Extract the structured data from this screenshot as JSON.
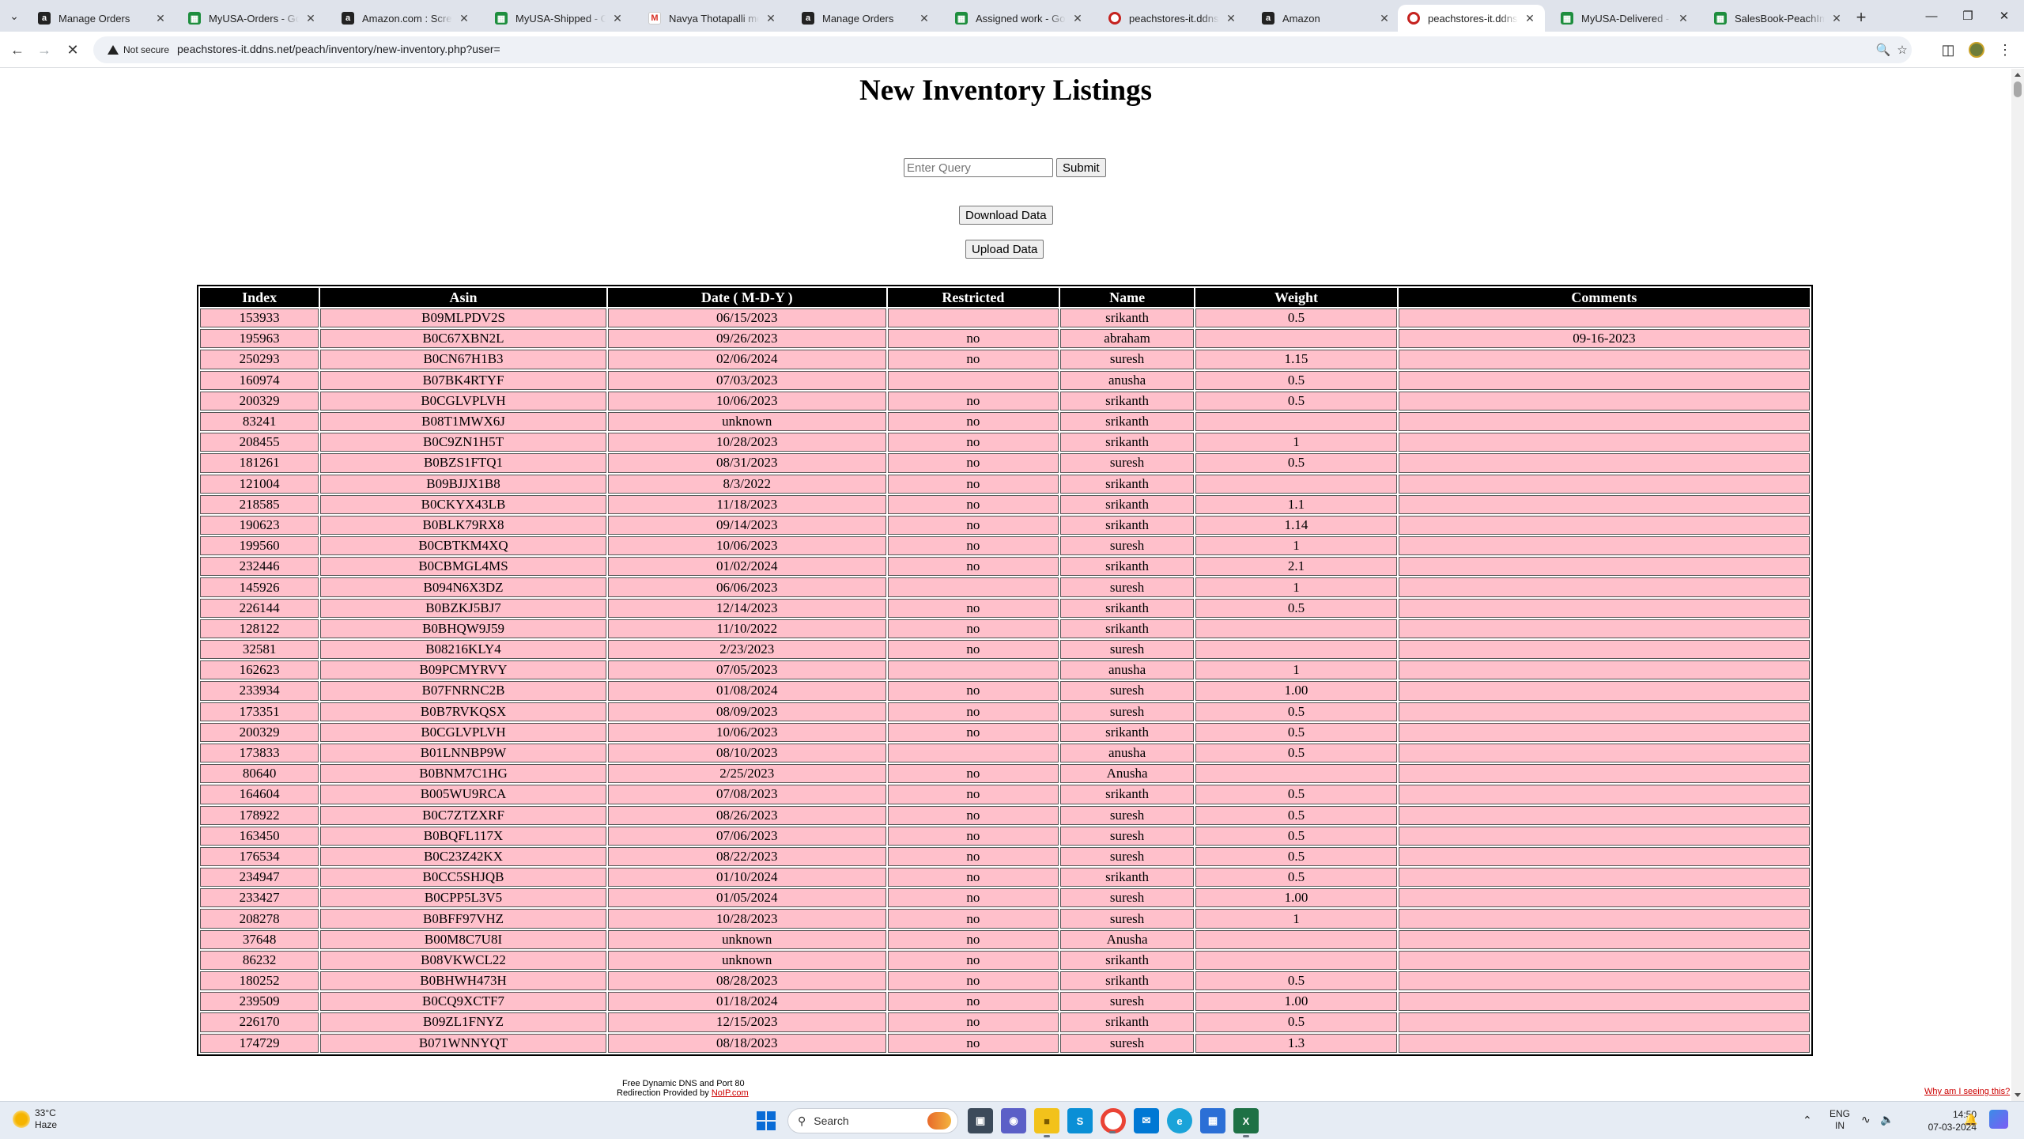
{
  "browser": {
    "tabs": [
      {
        "title": "Manage Orders",
        "favicon": "amazon-icon",
        "active": false
      },
      {
        "title": "MyUSA-Orders - Google Sheets",
        "favicon": "sheets-icon",
        "active": false
      },
      {
        "title": "Amazon.com : Screwdrivers",
        "favicon": "amazon-icon",
        "active": false
      },
      {
        "title": "MyUSA-Shipped - Google Sheets",
        "favicon": "sheets-icon",
        "active": false
      },
      {
        "title": "Navya Thotapalli messaged you",
        "favicon": "gmail-icon",
        "active": false
      },
      {
        "title": "Manage Orders",
        "favicon": "amazon-icon",
        "active": false
      },
      {
        "title": "Assigned work - Google Sheets",
        "favicon": "sheets-icon",
        "active": false
      },
      {
        "title": "peachstores-it.ddns.net",
        "favicon": "peach-icon",
        "active": false
      },
      {
        "title": "Amazon",
        "favicon": "amazon-icon",
        "active": false
      },
      {
        "title": "peachstores-it.ddns.net",
        "favicon": "peach-icon",
        "active": true
      },
      {
        "title": "MyUSA-Delivered - Google Sheets",
        "favicon": "sheets-icon",
        "active": false
      },
      {
        "title": "SalesBook-PeachImports",
        "favicon": "sheets-icon",
        "active": false
      }
    ],
    "security_label": "Not secure",
    "url": "peachstores-it.ddns.net/peach/inventory/new-inventory.php?user="
  },
  "page": {
    "title": "New Inventory Listings",
    "query_placeholder": "Enter Query",
    "submit_label": "Submit",
    "download_label": "Download Data",
    "upload_label": "Upload Data"
  },
  "table": {
    "headers": [
      "Index",
      "Asin",
      "Date ( M-D-Y )",
      "Restricted",
      "Name",
      "Weight",
      "Comments"
    ],
    "rows": [
      [
        "153933",
        "B09MLPDV2S",
        "06/15/2023",
        "",
        "srikanth",
        "0.5",
        ""
      ],
      [
        "195963",
        "B0C67XBN2L",
        "09/26/2023",
        "no",
        "abraham",
        "",
        "09-16-2023"
      ],
      [
        "250293",
        "B0CN67H1B3",
        "02/06/2024",
        "no",
        "suresh",
        "1.15",
        ""
      ],
      [
        "160974",
        "B07BK4RTYF",
        "07/03/2023",
        "",
        "anusha",
        "0.5",
        ""
      ],
      [
        "200329",
        "B0CGLVPLVH",
        "10/06/2023",
        "no",
        "srikanth",
        "0.5",
        ""
      ],
      [
        "83241",
        "B08T1MWX6J",
        "unknown",
        "no",
        "srikanth",
        "",
        ""
      ],
      [
        "208455",
        "B0C9ZN1H5T",
        "10/28/2023",
        "no",
        "srikanth",
        "1",
        ""
      ],
      [
        "181261",
        "B0BZS1FTQ1",
        "08/31/2023",
        "no",
        "suresh",
        "0.5",
        ""
      ],
      [
        "121004",
        "B09BJJX1B8",
        "8/3/2022",
        "no",
        "srikanth",
        "",
        ""
      ],
      [
        "218585",
        "B0CKYX43LB",
        "11/18/2023",
        "no",
        "srikanth",
        "1.1",
        ""
      ],
      [
        "190623",
        "B0BLK79RX8",
        "09/14/2023",
        "no",
        "srikanth",
        "1.14",
        ""
      ],
      [
        "199560",
        "B0CBTKM4XQ",
        "10/06/2023",
        "no",
        "suresh",
        "1",
        ""
      ],
      [
        "232446",
        "B0CBMGL4MS",
        "01/02/2024",
        "no",
        "srikanth",
        "2.1",
        ""
      ],
      [
        "145926",
        "B094N6X3DZ",
        "06/06/2023",
        "",
        "suresh",
        "1",
        ""
      ],
      [
        "226144",
        "B0BZKJ5BJ7",
        "12/14/2023",
        "no",
        "srikanth",
        "0.5",
        ""
      ],
      [
        "128122",
        "B0BHQW9J59",
        "11/10/2022",
        "no",
        "srikanth",
        "",
        ""
      ],
      [
        "32581",
        "B08216KLY4",
        "2/23/2023",
        "no",
        "suresh",
        "",
        ""
      ],
      [
        "162623",
        "B09PCMYRVY",
        "07/05/2023",
        "",
        "anusha",
        "1",
        ""
      ],
      [
        "233934",
        "B07FNRNC2B",
        "01/08/2024",
        "no",
        "suresh",
        "1.00",
        ""
      ],
      [
        "173351",
        "B0B7RVKQSX",
        "08/09/2023",
        "no",
        "suresh",
        "0.5",
        ""
      ],
      [
        "200329",
        "B0CGLVPLVH",
        "10/06/2023",
        "no",
        "srikanth",
        "0.5",
        ""
      ],
      [
        "173833",
        "B01LNNBP9W",
        "08/10/2023",
        "",
        "anusha",
        "0.5",
        ""
      ],
      [
        "80640",
        "B0BNM7C1HG",
        "2/25/2023",
        "no",
        "Anusha",
        "",
        ""
      ],
      [
        "164604",
        "B005WU9RCA",
        "07/08/2023",
        "no",
        "srikanth",
        "0.5",
        ""
      ],
      [
        "178922",
        "B0C7ZTZXRF",
        "08/26/2023",
        "no",
        "suresh",
        "0.5",
        ""
      ],
      [
        "163450",
        "B0BQFL117X",
        "07/06/2023",
        "no",
        "suresh",
        "0.5",
        ""
      ],
      [
        "176534",
        "B0C23Z42KX",
        "08/22/2023",
        "no",
        "suresh",
        "0.5",
        ""
      ],
      [
        "234947",
        "B0CC5SHJQB",
        "01/10/2024",
        "no",
        "srikanth",
        "0.5",
        ""
      ],
      [
        "233427",
        "B0CPP5L3V5",
        "01/05/2024",
        "no",
        "suresh",
        "1.00",
        ""
      ],
      [
        "208278",
        "B0BFF97VHZ",
        "10/28/2023",
        "no",
        "suresh",
        "1",
        ""
      ],
      [
        "37648",
        "B00M8C7U8I",
        "unknown",
        "no",
        "Anusha",
        "",
        ""
      ],
      [
        "86232",
        "B08VKWCL22",
        "unknown",
        "no",
        "srikanth",
        "",
        ""
      ],
      [
        "180252",
        "B0BHWH473H",
        "08/28/2023",
        "no",
        "srikanth",
        "0.5",
        ""
      ],
      [
        "239509",
        "B0CQ9XCTF7",
        "01/18/2024",
        "no",
        "suresh",
        "1.00",
        ""
      ],
      [
        "226170",
        "B09ZL1FNYZ",
        "12/15/2023",
        "no",
        "srikanth",
        "0.5",
        ""
      ],
      [
        "174729",
        "B071WNNYQT",
        "08/18/2023",
        "no",
        "suresh",
        "1.3",
        ""
      ]
    ]
  },
  "footer": {
    "line1": "Free Dynamic DNS and Port 80",
    "line2_prefix": "Redirection Provided by ",
    "line2_link": "NoIP.com",
    "why_link": "Why am I seeing this?"
  },
  "taskbar": {
    "temperature": "33°C",
    "condition": "Haze",
    "search_placeholder": "Search",
    "language": "ENG",
    "region": "IN",
    "time": "14:50",
    "date": "07-03-2024"
  }
}
